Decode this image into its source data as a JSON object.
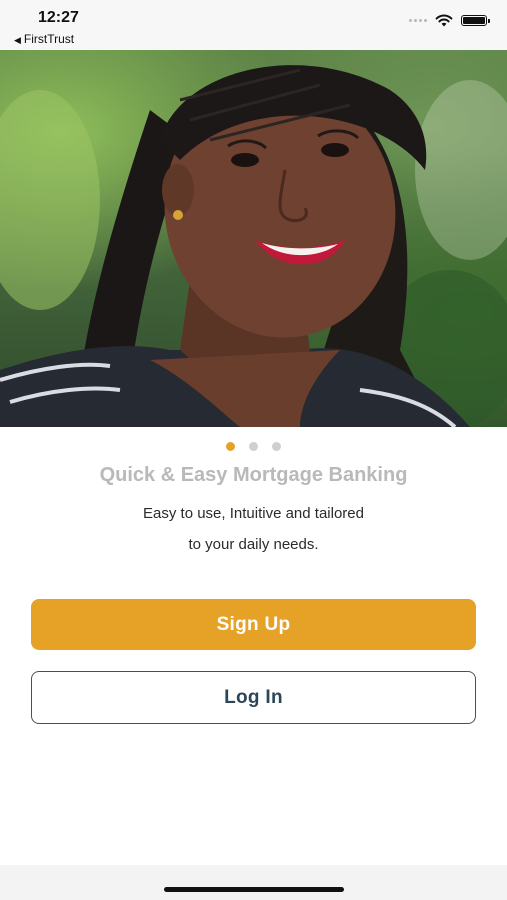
{
  "status_bar": {
    "time": "12:27",
    "back_app": "FirstTrust",
    "back_arrow": "◀"
  },
  "hero": {
    "image_subject": "smiling-woman-photo"
  },
  "pager": {
    "pages": 3,
    "active_index": 0
  },
  "onboarding": {
    "headline": "Quick & Easy Mortgage Banking",
    "subtitle_line1": "Easy to use, Intuitive and tailored",
    "subtitle_line2": "to your daily needs."
  },
  "actions": {
    "signup_label": "Sign Up",
    "login_label": "Log In"
  },
  "colors": {
    "accent": "#e6a227",
    "login_border": "#3f5460",
    "login_text": "#2d4756",
    "headline_gray": "#b9b9b9"
  }
}
